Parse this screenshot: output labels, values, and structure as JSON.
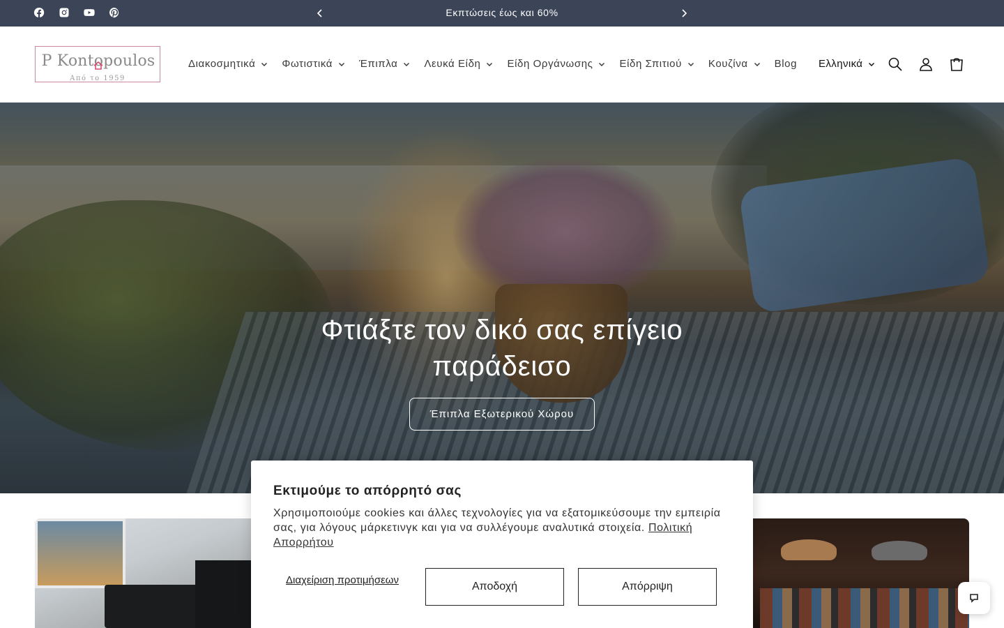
{
  "announcement": {
    "text": "Εκπτώσεις έως και 60%",
    "prev_icon": "chevron-left-icon",
    "next_icon": "chevron-right-icon",
    "background": "#3b4557"
  },
  "socials": [
    "facebook-icon",
    "instagram-icon",
    "youtube-icon",
    "pinterest-icon"
  ],
  "logo": {
    "name": "P Kontopoulos",
    "tagline": "Από το 1959",
    "accent": "#d24d6e"
  },
  "nav": {
    "items": [
      {
        "label": "Διακοσμητικά",
        "has_dropdown": true
      },
      {
        "label": "Φωτιστικά",
        "has_dropdown": true
      },
      {
        "label": "Έπιπλα",
        "has_dropdown": true
      },
      {
        "label": "Λευκά Είδη",
        "has_dropdown": true
      },
      {
        "label": "Είδη Οργάνωσης",
        "has_dropdown": true
      },
      {
        "label": "Είδη Σπιτιού",
        "has_dropdown": true
      },
      {
        "label": "Κουζίνα",
        "has_dropdown": true
      },
      {
        "label": "Blog",
        "has_dropdown": false
      }
    ]
  },
  "header": {
    "language": "Ελληνικά",
    "icons": [
      "search-icon",
      "account-icon",
      "cart-icon"
    ]
  },
  "hero": {
    "title": "Φτιάξτε τον δικό σας επίγειο παράδεισο",
    "button_label": "Έπιπλα Εξωτερικού Χώρου"
  },
  "cookie": {
    "title": "Εκτιμούμε το απόρρητό σας",
    "text": "Χρησιμοποιούμε cookies και άλλες τεχνολογίες για να εξατομικεύσουμε την εμπειρία σας, για λόγους μάρκετινγκ και για να συλλέγουμε αναλυτικά στοιχεία.",
    "link_label": "Πολιτική Απορρήτου",
    "manage_label": "Διαχείριση προτιμήσεων",
    "accept_label": "Αποδοχή",
    "reject_label": "Απόρριψη"
  },
  "chat": {
    "icon": "chat-icon"
  }
}
